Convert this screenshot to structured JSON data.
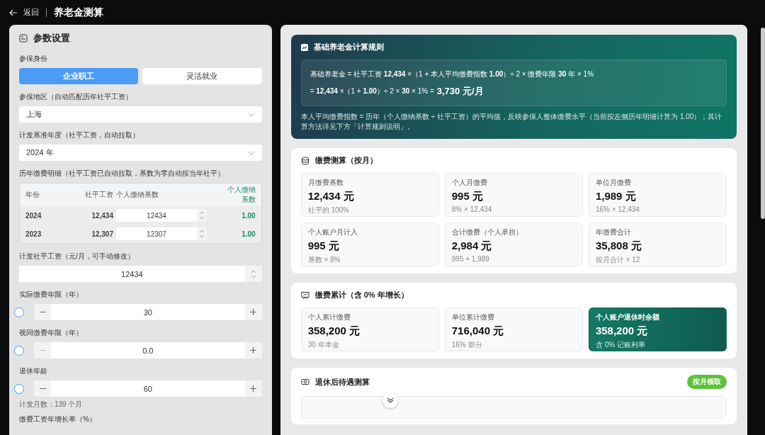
{
  "header": {
    "back": "返回",
    "title": "养老金测算"
  },
  "params": {
    "title": "参数设置",
    "identity": {
      "label": "参保身份",
      "options": [
        {
          "label": "企业职工",
          "selected": true
        },
        {
          "label": "灵活就业",
          "selected": false
        }
      ]
    },
    "region": {
      "label": "参保地区（自动匹配历年社平工资）",
      "value": "上海"
    },
    "base_year": {
      "label": "计发基准年度（社平工资，自动拉取）",
      "value": "2024 年"
    },
    "history": {
      "label": "历年缴费明细（社平工资已自动拉取，基数为零自动按当年社平）",
      "columns": [
        "年份",
        "社平工资",
        "个人缴纳基数",
        "个人缴纳系数"
      ],
      "rows": [
        {
          "year": "2024",
          "avg_wage": "12,434",
          "base": "12434",
          "index": "1.00"
        },
        {
          "year": "2023",
          "avg_wage": "12,307",
          "base": "12307",
          "index": "1.00"
        }
      ]
    },
    "avg_wage": {
      "label": "计发社平工资（元/月，可手动修改）",
      "value": "12434"
    },
    "steppers": [
      {
        "label": "实际缴费年限（年）",
        "value": "30",
        "minus_disabled": false
      },
      {
        "label": "视同缴费年限（年）",
        "value": "0.0",
        "minus_disabled": true
      },
      {
        "label": "退休年龄",
        "value": "60",
        "minus_disabled": false,
        "note": "计发月数：139 个月"
      }
    ],
    "growth": {
      "label": "缴费工资年增长率（%）"
    }
  },
  "rule": {
    "title": "基础养老金计算规则",
    "line_1": "基础养老金 = 社平工资 **12,434** ×（1 + 本人平均缴费指数 **1.00**）÷ 2 × 缴费年限 **30** 年 × 1%",
    "line_2": "= **12,434** ×（1 + **1.00**）÷ 2 × **30** × 1% =",
    "result": "3,730 元/月",
    "note": "本人平均缴费指数 = 历年（个人缴纳基数 ÷ 社平工资）的平均值，反映参保人整体缴费水平（当前按左侧历年明细计算为 1.00）；其计算方法详见下方「计算规则说明」。"
  },
  "monthly": {
    "title": "缴费测算（按月）",
    "stats": [
      {
        "label": "月缴费基数",
        "value": "12,434 元",
        "sub": "社平的 100%",
        "highlight": false
      },
      {
        "label": "个人月缴费",
        "value": "995 元",
        "sub": "8% × 12,434",
        "highlight": false
      },
      {
        "label": "单位月缴费",
        "value": "1,989 元",
        "sub": "16% × 12,434",
        "highlight": false
      },
      {
        "label": "个人账户月计入",
        "value": "995 元",
        "sub": "基数 × 8%",
        "highlight": false
      },
      {
        "label": "合计缴费（个人承担）",
        "value": "2,984 元",
        "sub": "995 + 1,989",
        "highlight": false
      },
      {
        "label": "年缴费合计",
        "value": "35,808 元",
        "sub": "按月合计 × 12",
        "highlight": false
      }
    ]
  },
  "accumulated": {
    "title": "缴费累计（含 0% 年增长）",
    "stats": [
      {
        "label": "个人累计缴费",
        "value": "358,200 元",
        "sub": "30 年本金",
        "highlight": false
      },
      {
        "label": "单位累计缴费",
        "value": "716,040 元",
        "sub": "16% 部分",
        "highlight": false
      },
      {
        "label": "个人账户退休时余额",
        "value": "358,200 元",
        "sub": "含 0% 记账利率",
        "highlight": true
      }
    ]
  },
  "retirement": {
    "title": "退休后待遇测算",
    "badge": "按月领取"
  }
}
